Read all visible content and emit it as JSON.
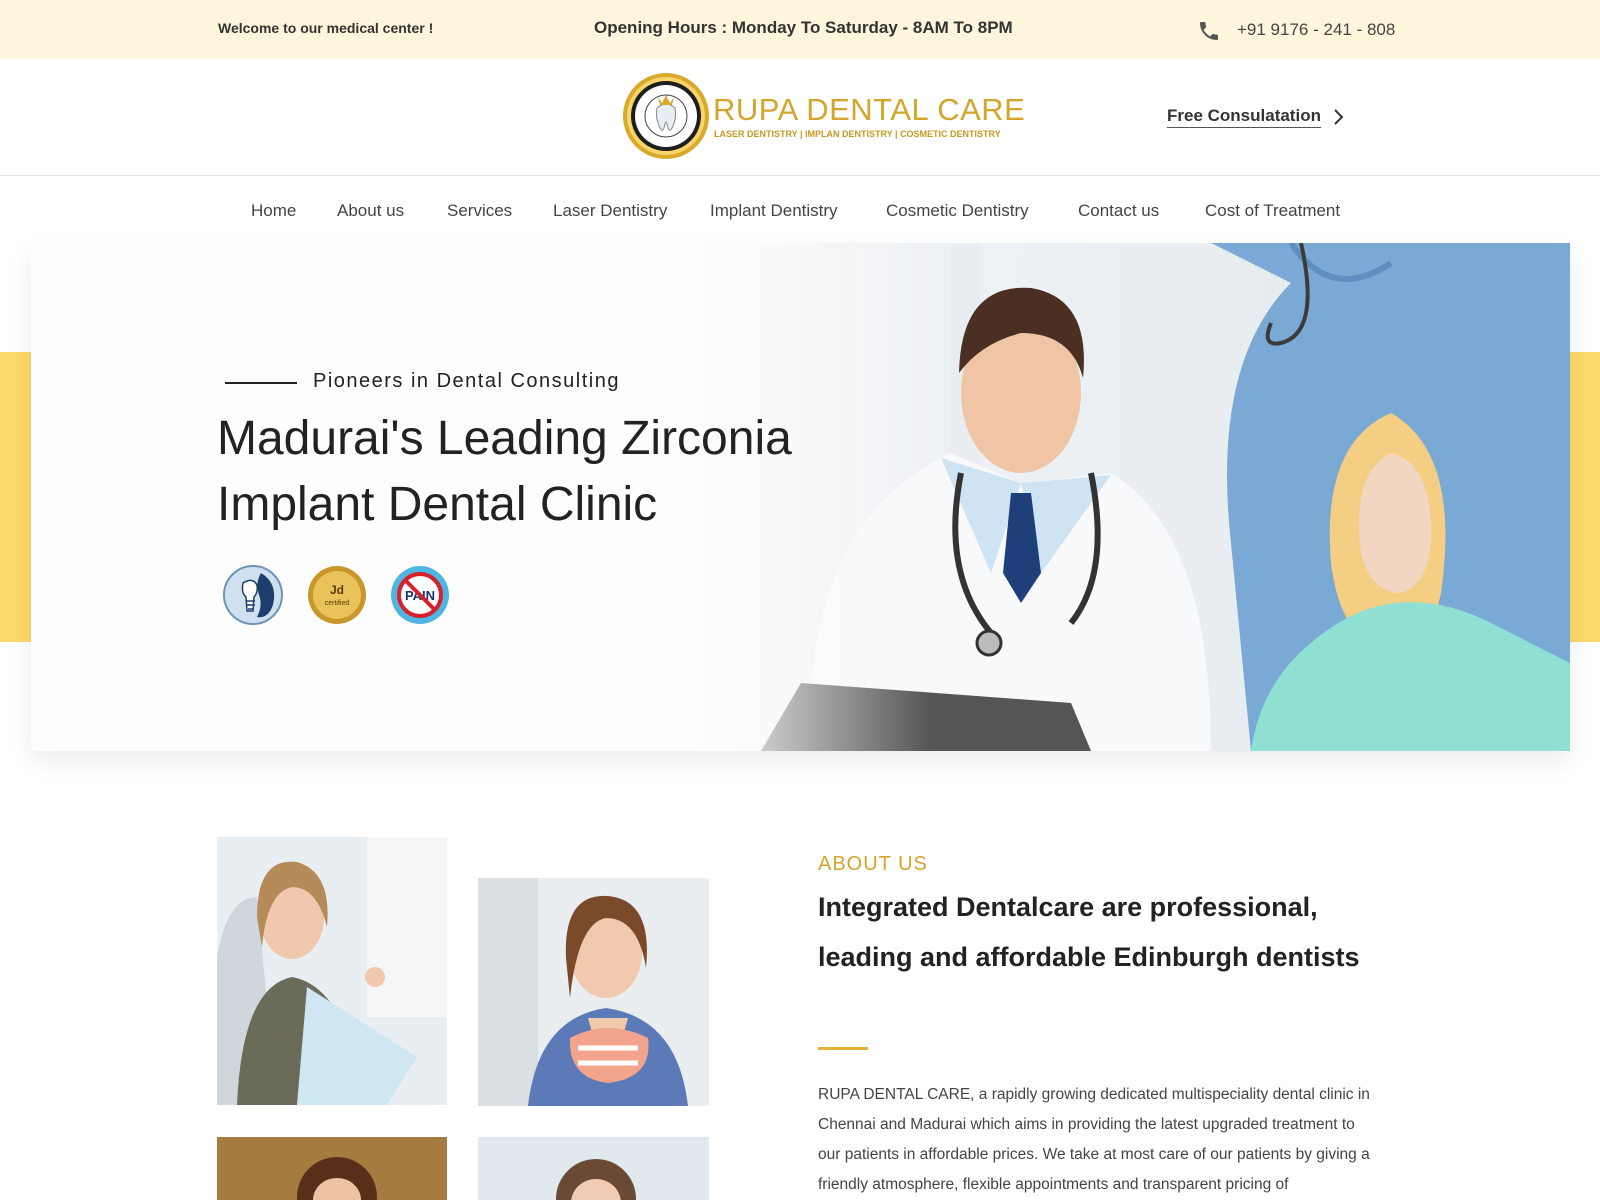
{
  "topbar": {
    "welcome": "Welcome to our medical center !",
    "hours": "Opening Hours : Monday To Saturday - 8AM To 8PM",
    "phone_icon": "phone-icon",
    "phone": "+91 9176 - 241 - 808"
  },
  "header": {
    "logo_title": "RUPA DENTAL CARE",
    "logo_tagline": "LASER DENTISTRY | IMPLAN DENTISTRY | COSMETIC DENTISTRY",
    "seal_text": "RUPA DENTAL CARE",
    "consult_label": "Free Consulatation",
    "consult_icon": "chevron-right-icon"
  },
  "nav": {
    "items": [
      {
        "label": "Home"
      },
      {
        "label": "About us"
      },
      {
        "label": "Services"
      },
      {
        "label": "Laser Dentistry"
      },
      {
        "label": "Implant Dentistry"
      },
      {
        "label": "Cosmetic Dentistry"
      },
      {
        "label": "Contact us"
      },
      {
        "label": "Cost of Treatment"
      }
    ]
  },
  "hero": {
    "kicker": "Pioneers in Dental Consulting",
    "title_line1": "Madurai's Leading Zirconia",
    "title_line2": "Implant Dental Clinic",
    "badges": [
      {
        "icon": "implant-badge-icon"
      },
      {
        "icon": "jd-certified-badge-icon",
        "text": "Jd",
        "subtext": "certified"
      },
      {
        "icon": "laser-pain-relief-badge-icon",
        "text": "PAIN"
      }
    ]
  },
  "about": {
    "kicker": "ABOUT US",
    "title": "Integrated Dentalcare are professional, leading and affordable Edinburgh dentists",
    "text": "RUPA DENTAL CARE, a rapidly growing dedicated multispeciality dental clinic in Chennai and Madurai which aims in providing the latest upgraded treatment to our patients in affordable prices. We take at most care of our patients by giving a friendly atmosphere, flexible appointments and transparent pricing of"
  },
  "colors": {
    "topbar_bg": "#fdf5dc",
    "accent": "#d4a52c",
    "hero_band": "#ffd86b"
  }
}
